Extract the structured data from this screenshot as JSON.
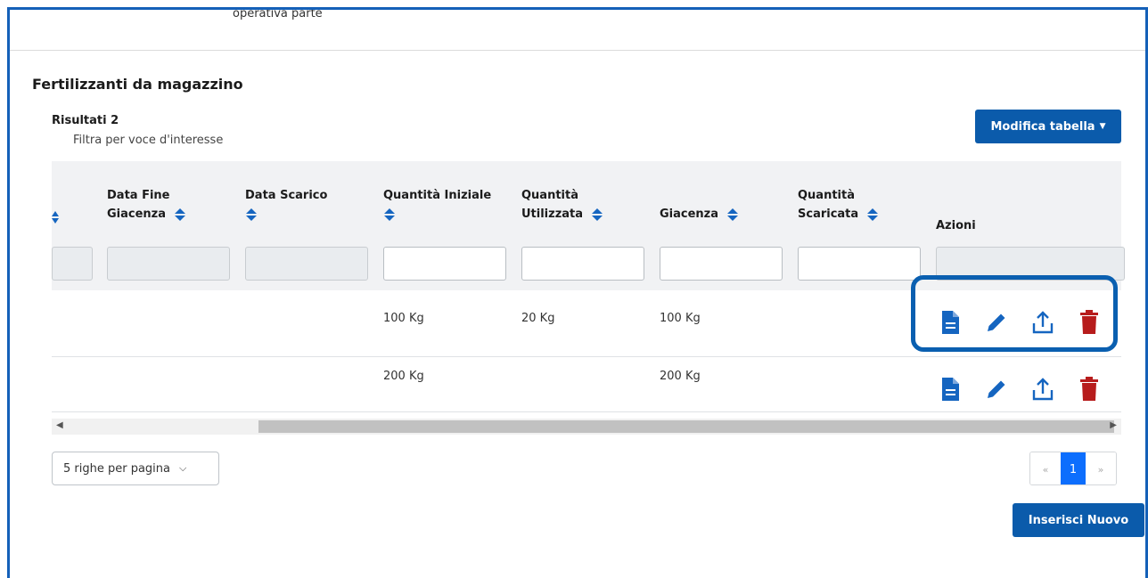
{
  "top_caption": "operativa parte",
  "section_title": "Fertilizzanti da magazzino",
  "results_label": "Risultati 2",
  "filter_hint": "Filtra per voce d'interesse",
  "buttons": {
    "modifica": "Modifica tabella",
    "inserisci": "Inserisci Nuovo"
  },
  "columns": [
    {
      "line1": "Data Fine",
      "line2": "Giacenza"
    },
    {
      "line1": "Data Scarico",
      "line2": ""
    },
    {
      "line1": "Quantità Iniziale",
      "line2": ""
    },
    {
      "line1": "Quantità",
      "line2": "Utilizzata"
    },
    {
      "line1": "Giacenza",
      "line2": ""
    },
    {
      "line1": "Quantità",
      "line2": "Scaricata"
    },
    {
      "line1": "Azioni",
      "line2": ""
    }
  ],
  "rows": [
    {
      "quantita_iniziale": "100 Kg",
      "quantita_utilizzata": "20 Kg",
      "giacenza": "100 Kg"
    },
    {
      "quantita_iniziale": "200 Kg",
      "quantita_utilizzata": "",
      "giacenza": "200 Kg"
    }
  ],
  "pagination": {
    "per_page_label": "5 righe per pagina",
    "prev": "«",
    "current": "1",
    "next": "»"
  },
  "colors": {
    "primary": "#0b5bab",
    "icon_blue": "#1565c0",
    "trash_red": "#b71c1c",
    "highlight": "#0a5fb0"
  },
  "icons": [
    "file-icon",
    "pencil-icon",
    "upload-icon",
    "trash-icon",
    "sort-icon",
    "chevron-down-icon"
  ]
}
